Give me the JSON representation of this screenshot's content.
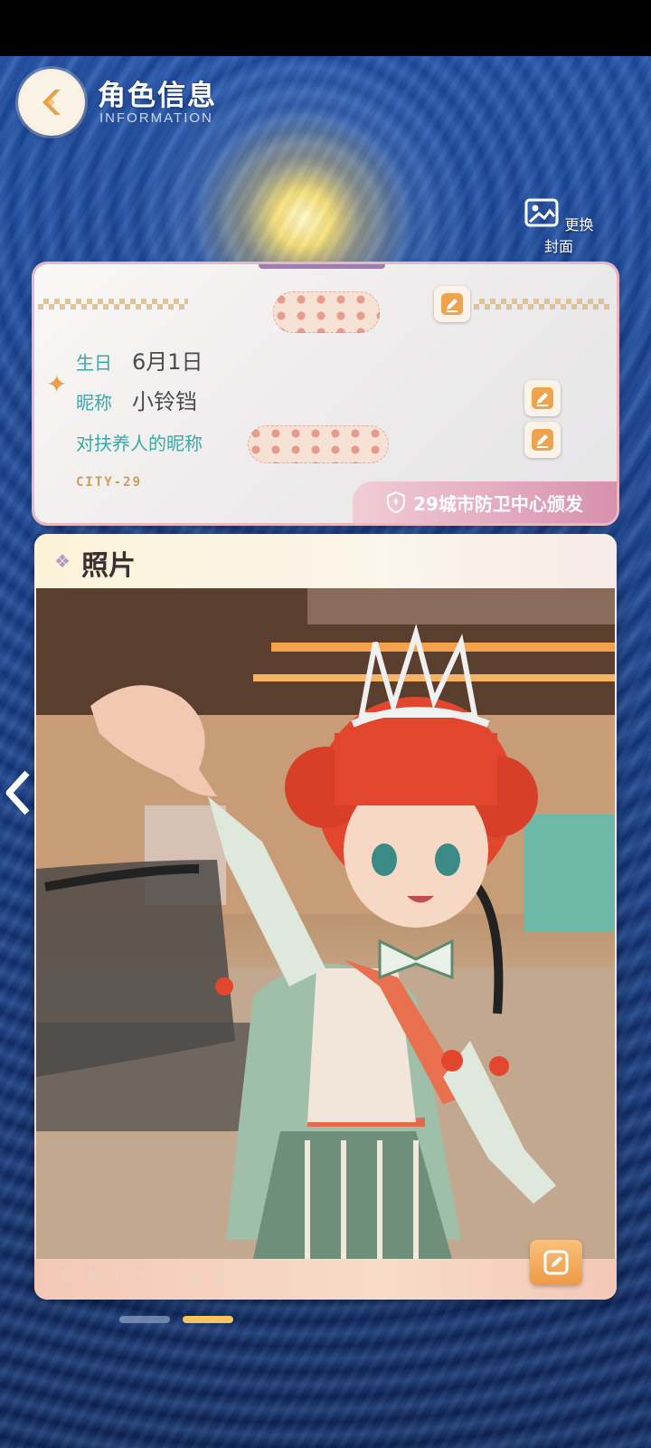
{
  "header": {
    "title": "角色信息",
    "subtitle": "INFORMATION",
    "back_icon": "chevron-left-icon"
  },
  "cover": {
    "label": "更换封面",
    "icon": "image-icon"
  },
  "info": {
    "birthday_label": "生日",
    "birthday_value": "6月1日",
    "nickname_label": "昵称",
    "nickname_value": "小铃铛",
    "guardian_nickname_label": "对扶养人的昵称",
    "city_code": "CITY-29",
    "issuer": "29城市防卫中心颁发"
  },
  "photo": {
    "title": "照片",
    "footer_code": "CITY-29"
  },
  "pager": {
    "count": 2,
    "active_index": 1
  },
  "colors": {
    "accent_teal": "#3aa8a6",
    "accent_gold": "#ee9a45",
    "issuer_pink": "#d790ad"
  }
}
